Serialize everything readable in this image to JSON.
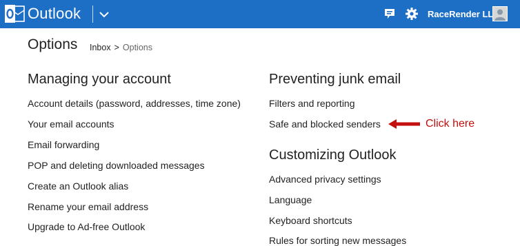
{
  "topbar": {
    "brand": "Outlook",
    "user_name": "RaceRender LLC",
    "colors": {
      "bar": "#1d6fc6",
      "text": "#ffffff"
    },
    "icons": [
      "outlook-logo-icon",
      "chevron-down-icon",
      "chat-icon",
      "gear-icon",
      "avatar"
    ]
  },
  "header": {
    "title": "Options",
    "breadcrumb": {
      "parent": "Inbox",
      "separator": ">",
      "current": "Options"
    }
  },
  "left_column": {
    "title": "Managing your account",
    "items": [
      "Account details (password, addresses, time zone)",
      "Your email accounts",
      "Email forwarding",
      "POP and deleting downloaded messages",
      "Create an Outlook alias",
      "Rename your email address",
      "Upgrade to Ad-free Outlook"
    ]
  },
  "right_column": {
    "junk_title": "Preventing junk email",
    "junk_items": [
      "Filters and reporting",
      "Safe and blocked senders"
    ],
    "custom_title": "Customizing Outlook",
    "custom_items": [
      "Advanced privacy settings",
      "Language",
      "Keyboard shortcuts",
      "Rules for sorting new messages"
    ]
  },
  "annotation": {
    "text": "Click here",
    "color": "#c40f0f"
  }
}
